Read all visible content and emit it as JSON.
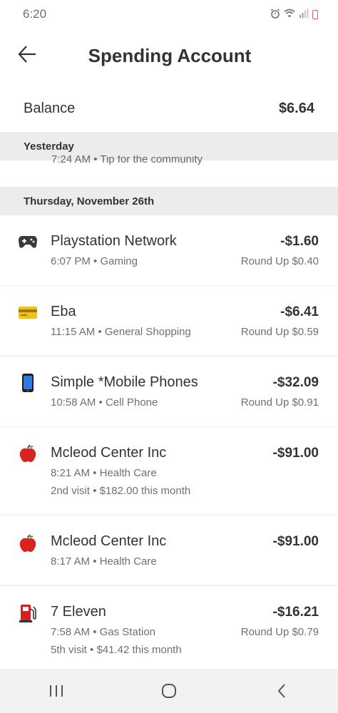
{
  "status_bar": {
    "time": "6:20"
  },
  "header": {
    "title": "Spending Account"
  },
  "balance": {
    "label": "Balance",
    "value": "$6.64"
  },
  "sections": [
    {
      "label": "Yesterday",
      "partial_row": "7:24 AM • Tip for the community"
    },
    {
      "label": "Thursday, November 26th"
    }
  ],
  "transactions": [
    {
      "merchant": "Playstation Network",
      "amount": "-$1.60",
      "meta": "6:07 PM • Gaming",
      "roundup": "Round Up $0.40",
      "icon": "gamepad-icon"
    },
    {
      "merchant": "Eba",
      "amount": "-$6.41",
      "meta": "11:15 AM • General Shopping",
      "roundup": "Round Up $0.59",
      "icon": "credit-card-icon"
    },
    {
      "merchant": "Simple *Mobile Phones",
      "amount": "-$32.09",
      "meta": "10:58 AM • Cell Phone",
      "roundup": "Round Up $0.91",
      "icon": "mobile-phone-icon"
    },
    {
      "merchant": "Mcleod Center Inc",
      "amount": "-$91.00",
      "meta": "8:21 AM • Health Care",
      "visit": "2nd visit • $182.00 this month",
      "icon": "apple-icon"
    },
    {
      "merchant": "Mcleod Center Inc",
      "amount": "-$91.00",
      "meta": "8:17 AM • Health Care",
      "icon": "apple-icon"
    },
    {
      "merchant": "7 Eleven",
      "amount": "-$16.21",
      "meta": "7:58 AM • Gas Station",
      "roundup": "Round Up $0.79",
      "visit": "5th visit • $41.42 this month",
      "icon": "fuel-pump-icon"
    }
  ],
  "colors": {
    "section_bg": "#ececec",
    "text": "#333333",
    "muted": "#707070",
    "nav_bg": "#f2f2f2"
  }
}
